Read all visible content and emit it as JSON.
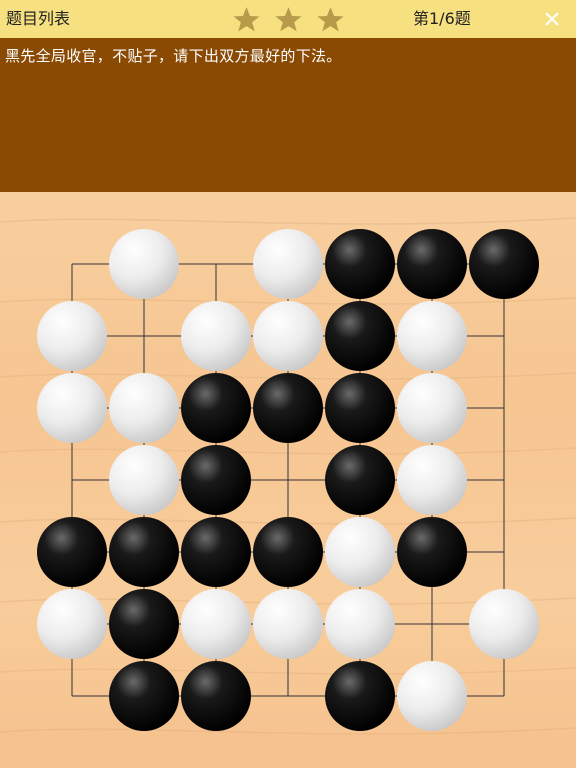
{
  "header": {
    "list_label": "题目列表",
    "star_icon_color": "#b79b4a",
    "stars": 3,
    "counter": "第1/6题"
  },
  "problem": {
    "description": "黑先全局收官，不贴子，请下出双方最好的下法。"
  },
  "board": {
    "size": 7,
    "line_color": "#333333",
    "board_color": "#f7c99a",
    "stones": [
      {
        "col": 1,
        "row": 0,
        "color": "white"
      },
      {
        "col": 3,
        "row": 0,
        "color": "white"
      },
      {
        "col": 4,
        "row": 0,
        "color": "black"
      },
      {
        "col": 5,
        "row": 0,
        "color": "black"
      },
      {
        "col": 6,
        "row": 0,
        "color": "black"
      },
      {
        "col": 0,
        "row": 1,
        "color": "white"
      },
      {
        "col": 2,
        "row": 1,
        "color": "white"
      },
      {
        "col": 3,
        "row": 1,
        "color": "white"
      },
      {
        "col": 4,
        "row": 1,
        "color": "black"
      },
      {
        "col": 5,
        "row": 1,
        "color": "white"
      },
      {
        "col": 0,
        "row": 2,
        "color": "white"
      },
      {
        "col": 1,
        "row": 2,
        "color": "white"
      },
      {
        "col": 2,
        "row": 2,
        "color": "black"
      },
      {
        "col": 3,
        "row": 2,
        "color": "black"
      },
      {
        "col": 4,
        "row": 2,
        "color": "black"
      },
      {
        "col": 5,
        "row": 2,
        "color": "white"
      },
      {
        "col": 1,
        "row": 3,
        "color": "white"
      },
      {
        "col": 2,
        "row": 3,
        "color": "black"
      },
      {
        "col": 4,
        "row": 3,
        "color": "black"
      },
      {
        "col": 5,
        "row": 3,
        "color": "white"
      },
      {
        "col": 0,
        "row": 4,
        "color": "black"
      },
      {
        "col": 1,
        "row": 4,
        "color": "black"
      },
      {
        "col": 2,
        "row": 4,
        "color": "black"
      },
      {
        "col": 3,
        "row": 4,
        "color": "black"
      },
      {
        "col": 4,
        "row": 4,
        "color": "white"
      },
      {
        "col": 5,
        "row": 4,
        "color": "black"
      },
      {
        "col": 0,
        "row": 5,
        "color": "white"
      },
      {
        "col": 1,
        "row": 5,
        "color": "black"
      },
      {
        "col": 2,
        "row": 5,
        "color": "white"
      },
      {
        "col": 3,
        "row": 5,
        "color": "white"
      },
      {
        "col": 4,
        "row": 5,
        "color": "white"
      },
      {
        "col": 6,
        "row": 5,
        "color": "white"
      },
      {
        "col": 1,
        "row": 6,
        "color": "black"
      },
      {
        "col": 2,
        "row": 6,
        "color": "black"
      },
      {
        "col": 4,
        "row": 6,
        "color": "black"
      },
      {
        "col": 5,
        "row": 6,
        "color": "white"
      }
    ]
  }
}
